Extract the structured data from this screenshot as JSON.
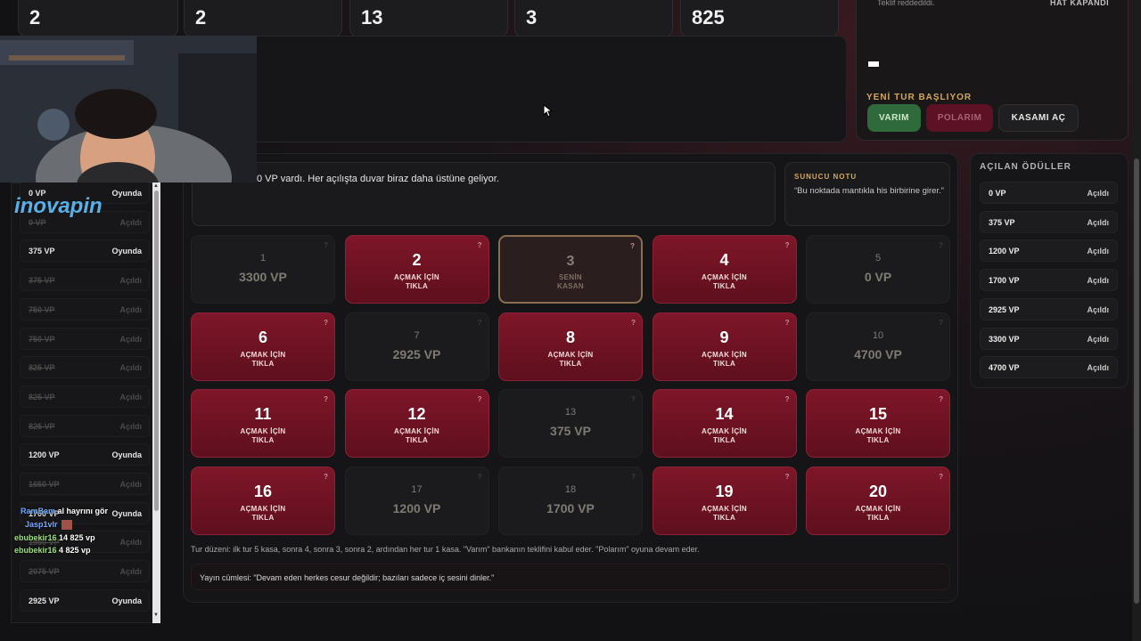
{
  "stats": [
    "2",
    "2",
    "13",
    "3",
    "825"
  ],
  "right_panel": {
    "rejected": "Teklif reddedildi.",
    "line_closed": "HAT KAPANDI",
    "new_round": "YENİ TUR BAŞLIYOR",
    "buttons": {
      "varim": "VARIM",
      "polarim": "POLARIM",
      "open_case": "KASAMI AÇ"
    }
  },
  "message": "0 VP vardı. Her açılışta duvar biraz daha üstüne geliyor.",
  "host_note": {
    "title": "SUNUCU NOTU",
    "text": "“Bu noktada mantıkla his birbirine girer.”"
  },
  "tiles": [
    {
      "num": "1",
      "state": "opened",
      "value": "3300 VP"
    },
    {
      "num": "2",
      "state": "closed",
      "label": [
        "AÇMAK İÇİN",
        "TIKLA"
      ]
    },
    {
      "num": "3",
      "state": "mine",
      "label": [
        "SENİN",
        "KASAN"
      ]
    },
    {
      "num": "4",
      "state": "closed",
      "label": [
        "AÇMAK İÇİN",
        "TIKLA"
      ]
    },
    {
      "num": "5",
      "state": "opened",
      "value": "0 VP"
    },
    {
      "num": "6",
      "state": "closed",
      "label": [
        "AÇMAK İÇİN",
        "TIKLA"
      ]
    },
    {
      "num": "7",
      "state": "opened",
      "value": "2925 VP"
    },
    {
      "num": "8",
      "state": "closed",
      "label": [
        "AÇMAK İÇİN",
        "TIKLA"
      ]
    },
    {
      "num": "9",
      "state": "closed",
      "label": [
        "AÇMAK İÇİN",
        "TIKLA"
      ]
    },
    {
      "num": "10",
      "state": "opened",
      "value": "4700 VP"
    },
    {
      "num": "11",
      "state": "closed",
      "label": [
        "AÇMAK İÇİN",
        "TIKLA"
      ]
    },
    {
      "num": "12",
      "state": "closed",
      "label": [
        "AÇMAK İÇİN",
        "TIKLA"
      ]
    },
    {
      "num": "13",
      "state": "opened",
      "value": "375 VP"
    },
    {
      "num": "14",
      "state": "closed",
      "label": [
        "AÇMAK İÇİN",
        "TIKLA"
      ]
    },
    {
      "num": "15",
      "state": "closed",
      "label": [
        "AÇMAK İÇİN",
        "TIKLA"
      ]
    },
    {
      "num": "16",
      "state": "closed",
      "label": [
        "AÇMAK İÇİN",
        "TIKLA"
      ]
    },
    {
      "num": "17",
      "state": "opened",
      "value": "1200 VP"
    },
    {
      "num": "18",
      "state": "opened",
      "value": "1700 VP"
    },
    {
      "num": "19",
      "state": "closed",
      "label": [
        "AÇMAK İÇİN",
        "TIKLA"
      ]
    },
    {
      "num": "20",
      "state": "closed",
      "label": [
        "AÇMAK İÇİN",
        "TIKLA"
      ]
    }
  ],
  "tile_question": "?",
  "rules": "Tur düzeni: ilk tur 5 kasa, sonra 4, sonra 3, sonra 2, ardından her tur 1 kasa. \"Varım\" bankanın teklifini kabul eder. \"Polarım\" oyuna devam eder.",
  "quote": "Yayın cümlesi: \"Devam eden herkes cesur değildir; bazıları sadece iç sesini dinler.\"",
  "rewards": {
    "title": "AÇILAN ÖDÜLLER",
    "items": [
      {
        "value": "0 VP",
        "status": "Açıldı"
      },
      {
        "value": "375 VP",
        "status": "Açıldı"
      },
      {
        "value": "1200 VP",
        "status": "Açıldı"
      },
      {
        "value": "1700 VP",
        "status": "Açıldı"
      },
      {
        "value": "2925 VP",
        "status": "Açıldı"
      },
      {
        "value": "3300 VP",
        "status": "Açıldı"
      },
      {
        "value": "4700 VP",
        "status": "Açıldı"
      }
    ]
  },
  "left_list": [
    {
      "value": "0 VP",
      "status": "Oyunda",
      "done": false
    },
    {
      "value": "0 VP",
      "status": "Açıldı",
      "done": true
    },
    {
      "value": "375 VP",
      "status": "Oyunda",
      "done": false
    },
    {
      "value": "375 VP",
      "status": "Açıldı",
      "done": true
    },
    {
      "value": "750 VP",
      "status": "Açıldı",
      "done": true
    },
    {
      "value": "750 VP",
      "status": "Açıldı",
      "done": true
    },
    {
      "value": "825 VP",
      "status": "Açıldı",
      "done": true
    },
    {
      "value": "825 VP",
      "status": "Açıldı",
      "done": true
    },
    {
      "value": "825 VP",
      "status": "Açıldı",
      "done": true
    },
    {
      "value": "1200 VP",
      "status": "Oyunda",
      "done": false
    },
    {
      "value": "1650 VP",
      "status": "Açıldı",
      "done": true
    },
    {
      "value": "1700 VP",
      "status": "Oyunda",
      "done": false
    },
    {
      "value": "1950 VP",
      "status": "Açıldı",
      "done": true
    },
    {
      "value": "2075 VP",
      "status": "Açıldı",
      "done": true
    },
    {
      "value": "2925 VP",
      "status": "Oyunda",
      "done": false
    }
  ],
  "logo": "inovapin",
  "chat": [
    {
      "user": "RamBam",
      "text": "al hayrını gör",
      "color": "#6aa8ff"
    },
    {
      "user": "Jasp1vlr",
      "text": "",
      "color": "#7aa6ff"
    },
    {
      "user": "ebubekir16",
      "text": "14 825 vp",
      "color": "#9be07a"
    },
    {
      "user": "ebubekir16",
      "text": "4 825 vp",
      "color": "#9be07a"
    }
  ],
  "colors": {
    "accent_gold": "#d4a75a",
    "tile_red": "#7e1628",
    "green": "#2f6b3a"
  }
}
